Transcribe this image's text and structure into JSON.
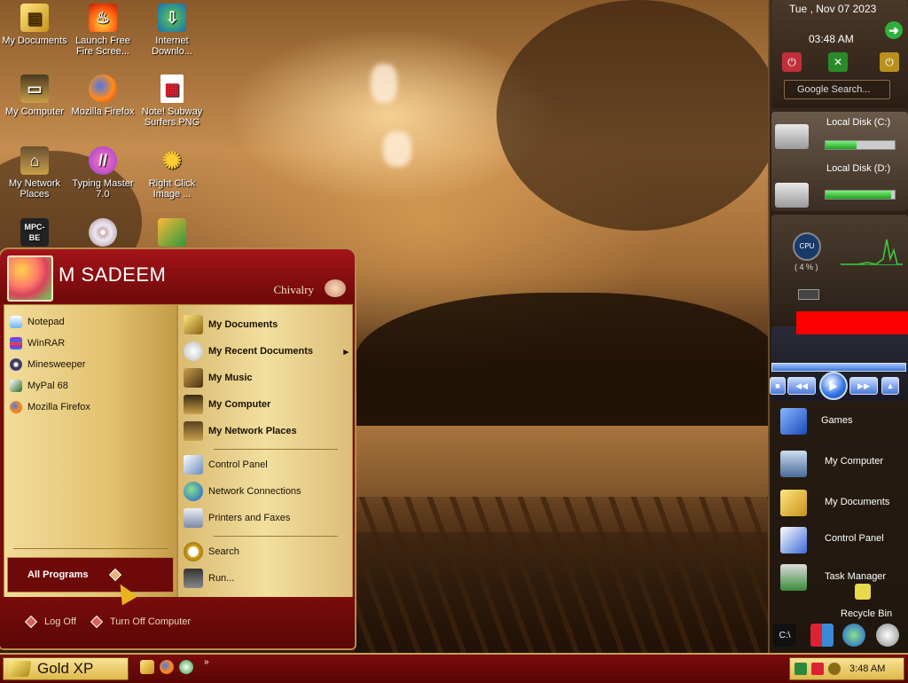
{
  "desktop": {
    "icons": [
      {
        "label": "My Documents",
        "icon": "folder-icon"
      },
      {
        "label": "Launch Free Fire Scree...",
        "icon": "fire-icon"
      },
      {
        "label": "Internet Downlo...",
        "icon": "download-manager-icon"
      },
      {
        "label": "My Computer",
        "icon": "computer-icon"
      },
      {
        "label": "Mozilla Firefox",
        "icon": "firefox-icon"
      },
      {
        "label": "Note! Subway Surfers.PNG",
        "icon": "image-file-icon"
      },
      {
        "label": "My Network Places",
        "icon": "network-icon"
      },
      {
        "label": "Typing Master 7.0",
        "icon": "typing-master-icon"
      },
      {
        "label": "Right Click Image ...",
        "icon": "gear-icon"
      },
      {
        "label": "MPC-BE",
        "icon": "clapperboard-icon"
      },
      {
        "label": "",
        "icon": "disc-icon"
      },
      {
        "label": "",
        "icon": "subway-surfers-icon"
      }
    ]
  },
  "start_menu": {
    "user_name": "M SADEEM",
    "theme_name": "Chivalry",
    "pinned": [
      "Notepad",
      "WinRAR",
      "Minesweeper",
      "MyPal 68",
      "Mozilla Firefox"
    ],
    "places": [
      "My Documents",
      "My Recent Documents",
      "My Music",
      "My Computer",
      "My Network Places"
    ],
    "system": [
      "Control Panel",
      "Network Connections",
      "Printers and Faxes"
    ],
    "tools": [
      "Search",
      "Run..."
    ],
    "all_programs": "All Programs",
    "log_off": "Log Off",
    "turn_off": "Turn Off Computer"
  },
  "sidebar": {
    "date": "Tue , Nov 07 2023",
    "time": "03:48 AM",
    "search_placeholder": "Google Search...",
    "disks": [
      {
        "label": "Local Disk (C:)",
        "used_fraction": 0.45
      },
      {
        "label": "Local Disk (D:)",
        "used_fraction": 0.95
      }
    ],
    "cpu_label": "CPU",
    "cpu_percent": "( 4 % )",
    "shortcuts": [
      "Games",
      "My Computer",
      "My Documents",
      "Control Panel",
      "Task Manager",
      "Recycle Bin"
    ]
  },
  "taskbar": {
    "start_label": "Gold XP",
    "more_label": "»",
    "clock": "3:48 AM"
  },
  "colors": {
    "accent": "#7a0c0c",
    "gold": "#e0b84a"
  }
}
